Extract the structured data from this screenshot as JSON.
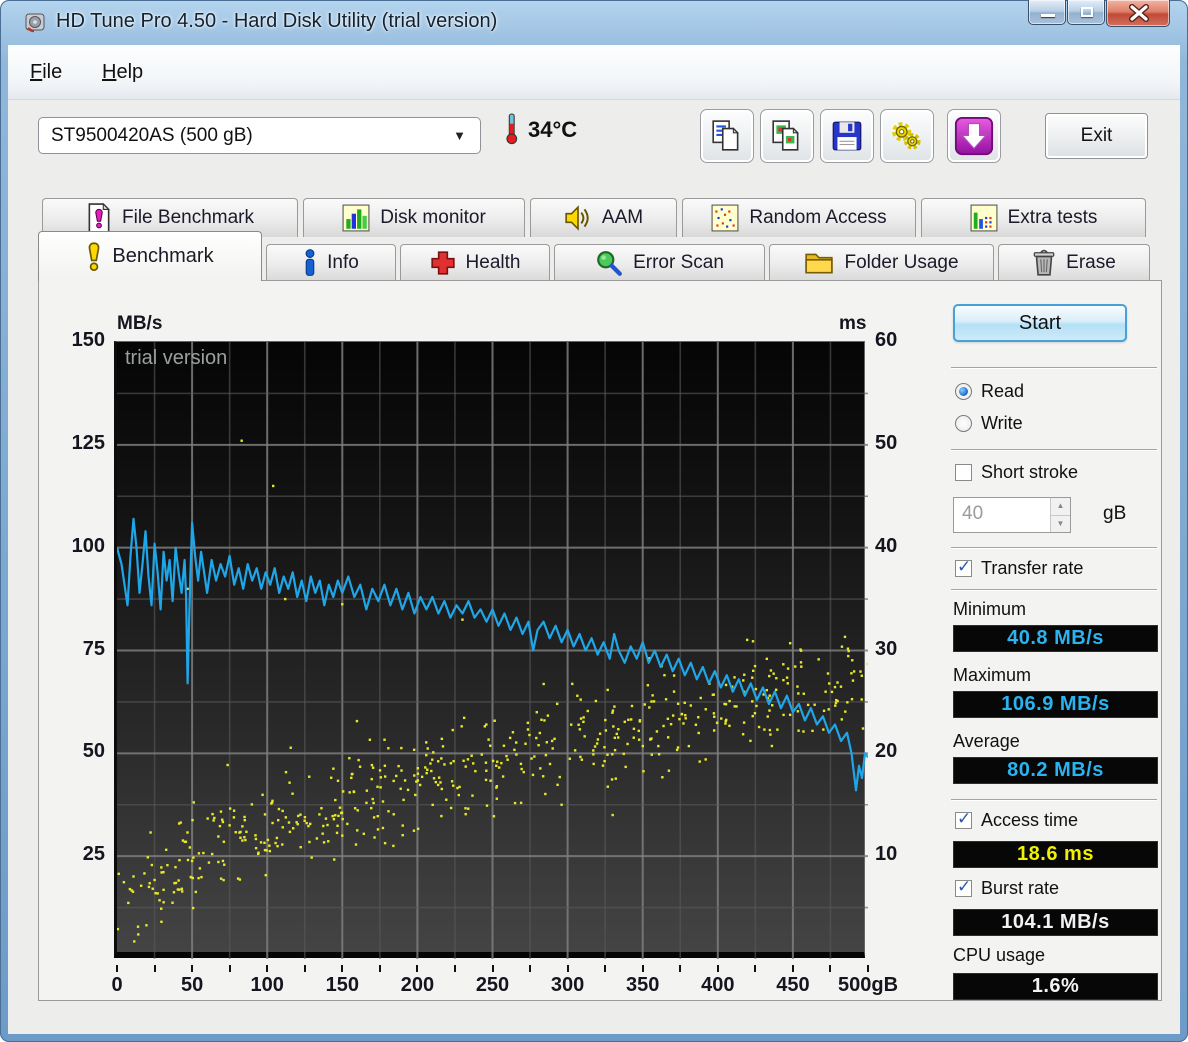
{
  "window": {
    "title": "HD Tune Pro 4.50 - Hard Disk Utility (trial version)"
  },
  "menu": {
    "items": [
      {
        "label": "File"
      },
      {
        "label": "Help"
      }
    ]
  },
  "drive_bar": {
    "selected_drive": "ST9500420AS (500 gB)",
    "temperature": "34°C"
  },
  "toolbar": {
    "buttons": [
      {
        "name": "copy-text-to-clipboard"
      },
      {
        "name": "copy-image-to-clipboard"
      },
      {
        "name": "save-screenshot"
      },
      {
        "name": "options"
      },
      {
        "name": "update-check"
      }
    ],
    "exit_label": "Exit"
  },
  "tabs": {
    "top_row": [
      {
        "label": "File Benchmark"
      },
      {
        "label": "Disk monitor"
      },
      {
        "label": "AAM"
      },
      {
        "label": "Random Access"
      },
      {
        "label": "Extra tests"
      }
    ],
    "bottom_row": [
      {
        "label": "Benchmark",
        "active": true
      },
      {
        "label": "Info"
      },
      {
        "label": "Health"
      },
      {
        "label": "Error Scan"
      },
      {
        "label": "Folder Usage"
      },
      {
        "label": "Erase"
      }
    ]
  },
  "chart_data": {
    "type": "line+scatter",
    "watermark": "trial version",
    "x_axis": {
      "unit": "gB",
      "min": 0,
      "max": 500,
      "ticks": [
        0,
        50,
        100,
        150,
        200,
        250,
        300,
        350,
        400,
        450,
        500
      ],
      "minor_step": 25
    },
    "y_left": {
      "label": "MB/s",
      "min": 0,
      "max": 150,
      "ticks": [
        150,
        125,
        100,
        75,
        50,
        25
      ],
      "minor_step": 12.5
    },
    "y_right": {
      "label": "ms",
      "min": 0,
      "max": 60,
      "ticks": [
        60,
        50,
        40,
        30,
        20,
        10
      ]
    },
    "grid": {
      "major_color": "#7e7e7e",
      "minor_color": "#585858"
    },
    "series": [
      {
        "name": "transfer-rate",
        "type": "line",
        "axis": "left",
        "color": "#1fa6e8",
        "points": [
          [
            0,
            100
          ],
          [
            3,
            96
          ],
          [
            5,
            91
          ],
          [
            7,
            86
          ],
          [
            9,
            98
          ],
          [
            11,
            107
          ],
          [
            13,
            100
          ],
          [
            15,
            89
          ],
          [
            17,
            96
          ],
          [
            19,
            104
          ],
          [
            21,
            93
          ],
          [
            23,
            86
          ],
          [
            25,
            101
          ],
          [
            27,
            94
          ],
          [
            29,
            85
          ],
          [
            31,
            99
          ],
          [
            33,
            92
          ],
          [
            35,
            97
          ],
          [
            37,
            87
          ],
          [
            39,
            100
          ],
          [
            41,
            94
          ],
          [
            43,
            89
          ],
          [
            45,
            97
          ],
          [
            46,
            88
          ],
          [
            47,
            67
          ],
          [
            48,
            82
          ],
          [
            49,
            95
          ],
          [
            50,
            106
          ],
          [
            52,
            98
          ],
          [
            54,
            92
          ],
          [
            56,
            99
          ],
          [
            58,
            94
          ],
          [
            60,
            89
          ],
          [
            63,
            97
          ],
          [
            66,
            92
          ],
          [
            69,
            96
          ],
          [
            72,
            93
          ],
          [
            75,
            98
          ],
          [
            78,
            91
          ],
          [
            81,
            95
          ],
          [
            84,
            90
          ],
          [
            87,
            96
          ],
          [
            90,
            92
          ],
          [
            93,
            95
          ],
          [
            96,
            90
          ],
          [
            99,
            94
          ],
          [
            102,
            91
          ],
          [
            105,
            95
          ],
          [
            108,
            89
          ],
          [
            111,
            93
          ],
          [
            114,
            90
          ],
          [
            117,
            94
          ],
          [
            120,
            88
          ],
          [
            123,
            92
          ],
          [
            126,
            87
          ],
          [
            129,
            93
          ],
          [
            132,
            89
          ],
          [
            135,
            92
          ],
          [
            138,
            86
          ],
          [
            141,
            91
          ],
          [
            144,
            88
          ],
          [
            147,
            92
          ],
          [
            150,
            89
          ],
          [
            154,
            93
          ],
          [
            158,
            88
          ],
          [
            162,
            91
          ],
          [
            166,
            85
          ],
          [
            170,
            90
          ],
          [
            174,
            87
          ],
          [
            178,
            91
          ],
          [
            182,
            86
          ],
          [
            186,
            90
          ],
          [
            190,
            85
          ],
          [
            194,
            89
          ],
          [
            198,
            84
          ],
          [
            202,
            88
          ],
          [
            206,
            85
          ],
          [
            210,
            88
          ],
          [
            214,
            84
          ],
          [
            218,
            87
          ],
          [
            222,
            83
          ],
          [
            226,
            86
          ],
          [
            230,
            84
          ],
          [
            234,
            87
          ],
          [
            238,
            83
          ],
          [
            242,
            85
          ],
          [
            246,
            82
          ],
          [
            250,
            85
          ],
          [
            254,
            81
          ],
          [
            258,
            84
          ],
          [
            262,
            80
          ],
          [
            266,
            83
          ],
          [
            270,
            79
          ],
          [
            274,
            82
          ],
          [
            277,
            75
          ],
          [
            280,
            80
          ],
          [
            284,
            82
          ],
          [
            288,
            78
          ],
          [
            292,
            81
          ],
          [
            296,
            77
          ],
          [
            300,
            80
          ],
          [
            304,
            76
          ],
          [
            308,
            79
          ],
          [
            312,
            75
          ],
          [
            316,
            78
          ],
          [
            320,
            74
          ],
          [
            324,
            77
          ],
          [
            328,
            73
          ],
          [
            331,
            79
          ],
          [
            334,
            75
          ],
          [
            338,
            72
          ],
          [
            342,
            76
          ],
          [
            346,
            73
          ],
          [
            350,
            77
          ],
          [
            354,
            72
          ],
          [
            358,
            75
          ],
          [
            362,
            71
          ],
          [
            366,
            74
          ],
          [
            370,
            70
          ],
          [
            374,
            73
          ],
          [
            378,
            69
          ],
          [
            382,
            72
          ],
          [
            386,
            68
          ],
          [
            390,
            71
          ],
          [
            394,
            67
          ],
          [
            398,
            70
          ],
          [
            402,
            66
          ],
          [
            406,
            69
          ],
          [
            410,
            65
          ],
          [
            414,
            68
          ],
          [
            418,
            64
          ],
          [
            422,
            67
          ],
          [
            426,
            63
          ],
          [
            430,
            66
          ],
          [
            434,
            62
          ],
          [
            438,
            65
          ],
          [
            442,
            61
          ],
          [
            446,
            64
          ],
          [
            450,
            60
          ],
          [
            454,
            62
          ],
          [
            458,
            58
          ],
          [
            462,
            61
          ],
          [
            466,
            57
          ],
          [
            470,
            59
          ],
          [
            474,
            55
          ],
          [
            478,
            57
          ],
          [
            482,
            53
          ],
          [
            486,
            55
          ],
          [
            489,
            50
          ],
          [
            492,
            41
          ],
          [
            494,
            47
          ],
          [
            496,
            44
          ],
          [
            498,
            50
          ],
          [
            500,
            49
          ]
        ]
      },
      {
        "name": "access-time",
        "type": "scatter",
        "axis": "right",
        "color": "#e9e92a",
        "model": {
          "count": 560,
          "seed": 1337,
          "base_start": 3.5,
          "base_end": 27,
          "exponent": 0.6,
          "spread": 5.5,
          "outlier_rate": 0.06,
          "outlier_extra": 8,
          "min": 1.5,
          "max": 34.5
        },
        "extra_points": [
          [
            104,
            46
          ],
          [
            83,
            50.4
          ],
          [
            150,
            34.5
          ],
          [
            112,
            35
          ],
          [
            230,
            33
          ],
          [
            47,
            36
          ],
          [
            184,
            11
          ],
          [
            150,
            12
          ],
          [
            296,
            15
          ],
          [
            330,
            14
          ]
        ]
      }
    ],
    "stats": {
      "minimum_mbs": 40.8,
      "maximum_mbs": 106.9,
      "average_mbs": 80.2,
      "access_time_ms": 18.6,
      "burst_rate_mbs": 104.1,
      "cpu_usage_pct": 1.6
    }
  },
  "side_panel": {
    "start_label": "Start",
    "mode": {
      "read_label": "Read",
      "write_label": "Write",
      "read_selected": true,
      "write_selected": false
    },
    "short_stroke": {
      "label": "Short stroke",
      "checked": false,
      "capacity_value": "40",
      "capacity_unit": "gB"
    },
    "transfer_rate": {
      "label": "Transfer rate",
      "checked": true,
      "minimum": {
        "label": "Minimum",
        "value": "40.8 MB/s"
      },
      "maximum": {
        "label": "Maximum",
        "value": "106.9 MB/s"
      },
      "average": {
        "label": "Average",
        "value": "80.2 MB/s"
      }
    },
    "access_time": {
      "label": "Access time",
      "checked": true,
      "value": "18.6 ms"
    },
    "burst_rate": {
      "label": "Burst rate",
      "checked": true,
      "value": "104.1 MB/s"
    },
    "cpu_usage": {
      "label": "CPU usage",
      "value": "1.6%"
    },
    "colors": {
      "transfer_value": "#2bb3f0",
      "access_value": "#f0f000",
      "plain_value": "#f2f2f2"
    }
  }
}
